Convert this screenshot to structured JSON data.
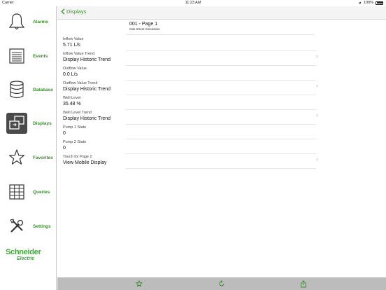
{
  "status": {
    "carrier": "Carrier",
    "time": "11:23 AM",
    "battery": "100%"
  },
  "sidebar": {
    "items": [
      {
        "label": "Alarms",
        "icon": "bell-icon"
      },
      {
        "label": "Events",
        "icon": "list-icon"
      },
      {
        "label": "Database",
        "icon": "database-icon"
      },
      {
        "label": "Displays",
        "icon": "displays-icon",
        "active": true
      },
      {
        "label": "Favorites",
        "icon": "star-icon"
      },
      {
        "label": "Queries",
        "icon": "grid-icon"
      },
      {
        "label": "Settings",
        "icon": "tools-icon"
      }
    ],
    "logo": {
      "line1": "Schneider",
      "line2": "Electric"
    }
  },
  "nav": {
    "back_label": "Displays"
  },
  "page": {
    "title": "001 - Page 1",
    "subtitle": "Oak Street Simulation"
  },
  "rows": [
    {
      "label": "Inflow Value",
      "value": "5.71 L/s",
      "link": false
    },
    {
      "label": "Inflow Value Trend",
      "value": "Display Historic Trend",
      "link": true
    },
    {
      "label": "Outflow Value",
      "value": "0.0 L/s",
      "link": false
    },
    {
      "label": "Outflow Value Trend",
      "value": "Display Historic Trend",
      "link": true
    },
    {
      "label": "Well Level",
      "value": "35.48 %",
      "link": false
    },
    {
      "label": "Well Level Trend",
      "value": "Display Historic Trend",
      "link": true
    },
    {
      "label": "Pump 1 State",
      "value": "0",
      "link": false
    },
    {
      "label": "Pump 2 State",
      "value": "0",
      "link": false
    },
    {
      "label": "Touch for Page 2",
      "value": "View Mobile Display",
      "link": true
    }
  ],
  "toolbar": {
    "icons": [
      "star-icon",
      "refresh-icon",
      "share-icon"
    ]
  },
  "colors": {
    "accent": "#3a8a2c",
    "logo": "#3aaa35",
    "toolbar": "#bcbcbc"
  }
}
